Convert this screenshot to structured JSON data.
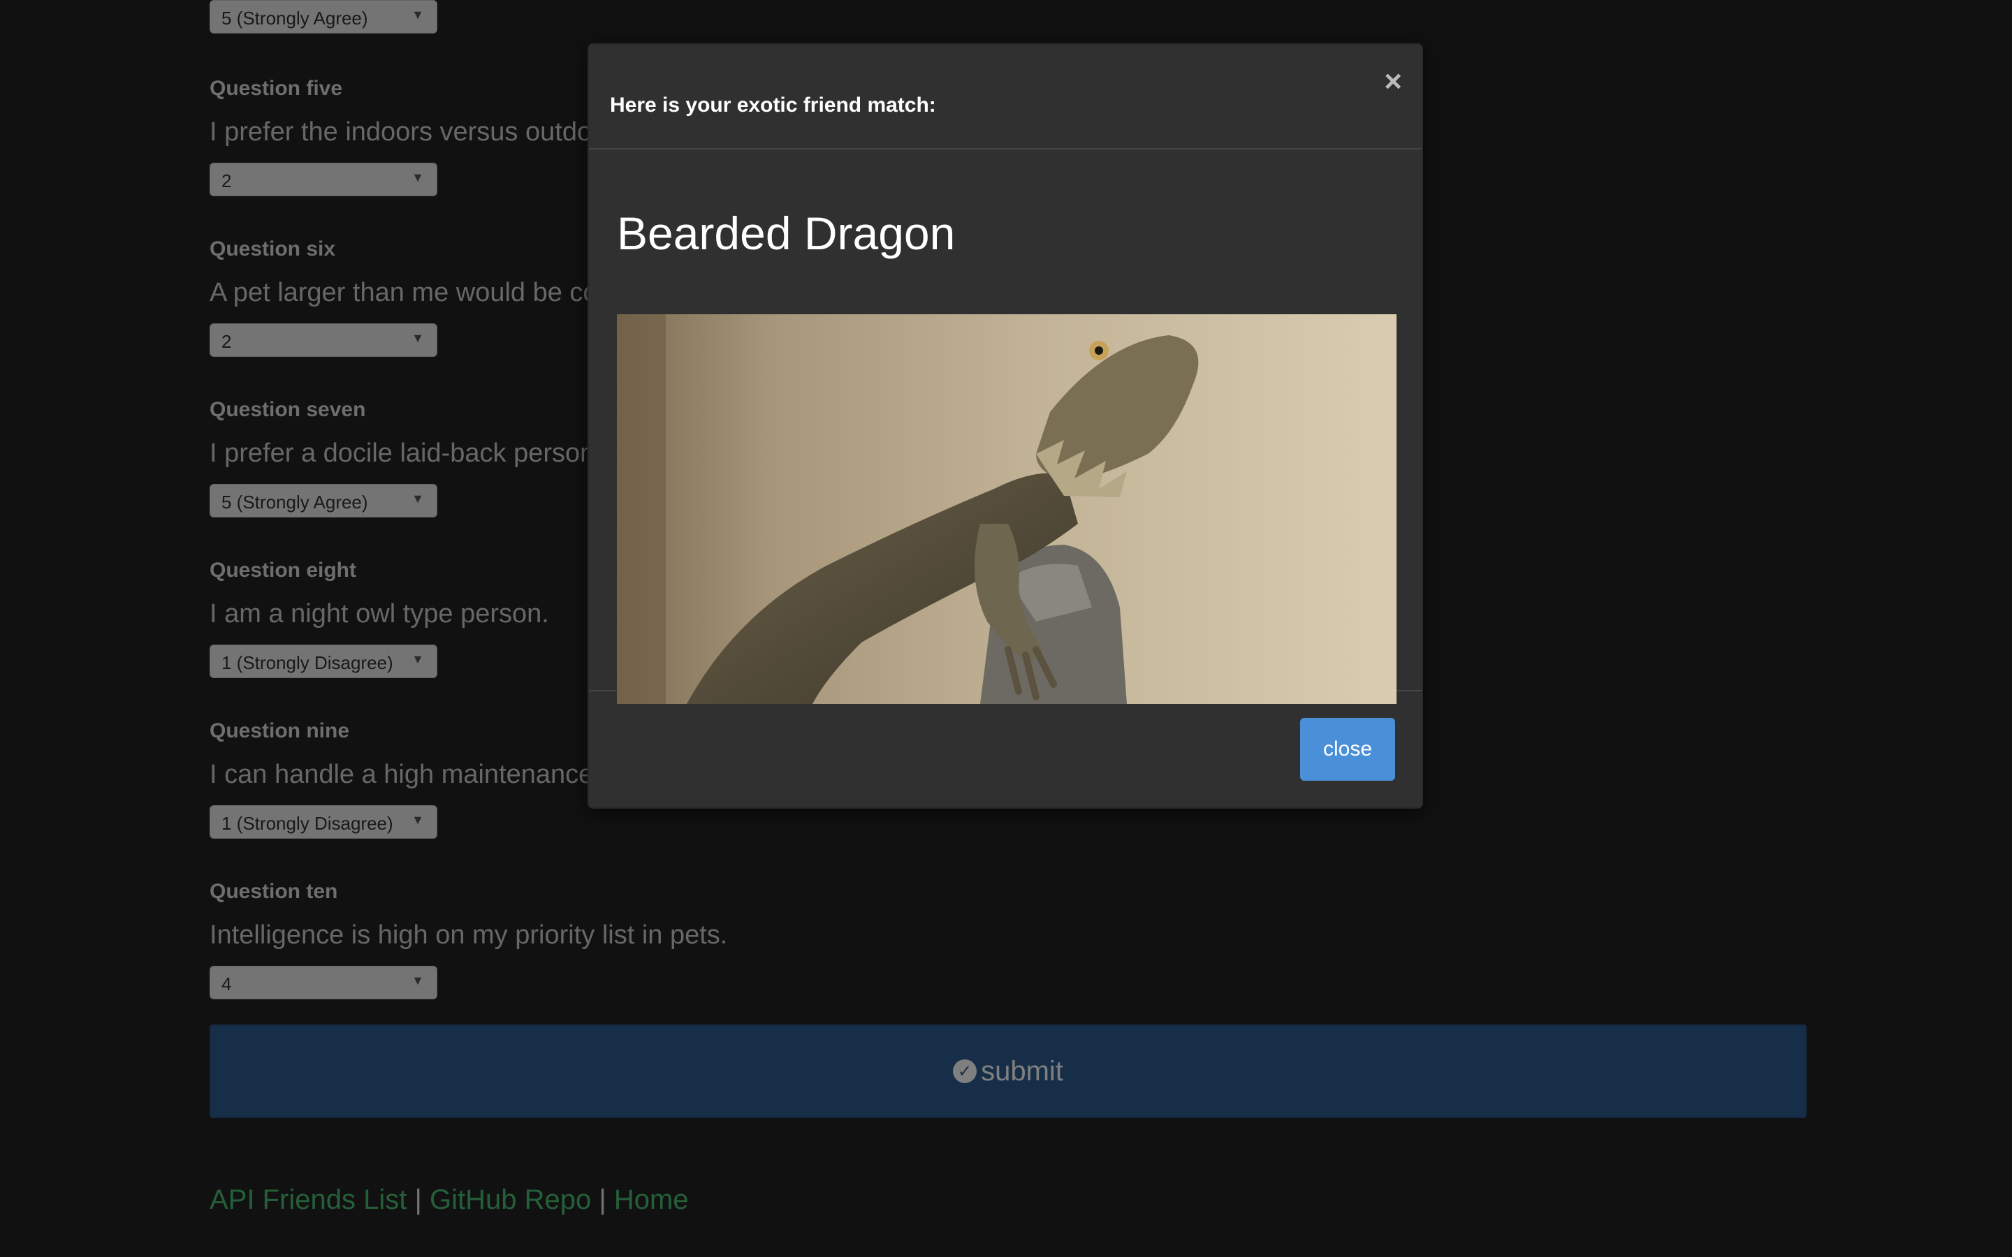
{
  "questions": [
    {
      "title": "",
      "text": "",
      "answer": "5 (Strongly Agree)"
    },
    {
      "title": "Question five",
      "text": "I prefer the indoors versus outdo",
      "answer": "2"
    },
    {
      "title": "Question six",
      "text": "A pet larger than me would be co",
      "answer": "2"
    },
    {
      "title": "Question seven",
      "text": "I prefer a docile laid-back person",
      "answer": "5 (Strongly Agree)"
    },
    {
      "title": "Question eight",
      "text": "I am a night owl type person.",
      "answer": "1 (Strongly Disagree)"
    },
    {
      "title": "Question nine",
      "text": "I can handle a high maintenance p",
      "answer": "1 (Strongly Disagree)"
    },
    {
      "title": "Question ten",
      "text": "Intelligence is high on my priority list in pets.",
      "answer": "4"
    }
  ],
  "submit": {
    "label": "submit",
    "icon": "check-circle-icon"
  },
  "footer": {
    "link1": "API Friends List",
    "sep1": "|",
    "link2": "GitHub Repo",
    "sep2": "|",
    "link3": "Home"
  },
  "modal": {
    "title": "Here is your exotic friend match:",
    "close_x": "×",
    "pet_name": "Bearded Dragon",
    "close_label": "close"
  },
  "colors": {
    "accent": "#4a90d9",
    "submit": "#2e5d92",
    "link": "#4bbf73"
  }
}
